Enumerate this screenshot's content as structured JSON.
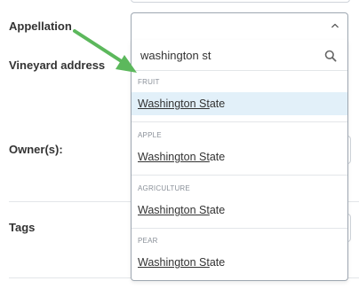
{
  "form": {
    "appellation_label": "Appellation",
    "vineyard_address_label": "Vineyard address",
    "owners_label": "Owner(s):",
    "tags_label": "Tags"
  },
  "select": {
    "value": ""
  },
  "dropdown": {
    "search_value": "washington st",
    "groups": [
      {
        "header": "FRUIT",
        "option": {
          "match": "Washington St",
          "rest": "ate"
        },
        "highlighted": true
      },
      {
        "header": "APPLE",
        "option": {
          "match": "Washington St",
          "rest": "ate"
        },
        "highlighted": false
      },
      {
        "header": "AGRICULTURE",
        "option": {
          "match": "Washington St",
          "rest": "ate"
        },
        "highlighted": false
      },
      {
        "header": "PEAR",
        "option": {
          "match": "Washington St",
          "rest": "ate"
        },
        "highlighted": false
      }
    ]
  },
  "colors": {
    "highlight": "#e2f0f9",
    "arrow": "#5cb85c"
  },
  "icons": {
    "chevron": "chevron-up-icon",
    "search": "search-icon",
    "arrow": "annotation-arrow-icon"
  }
}
